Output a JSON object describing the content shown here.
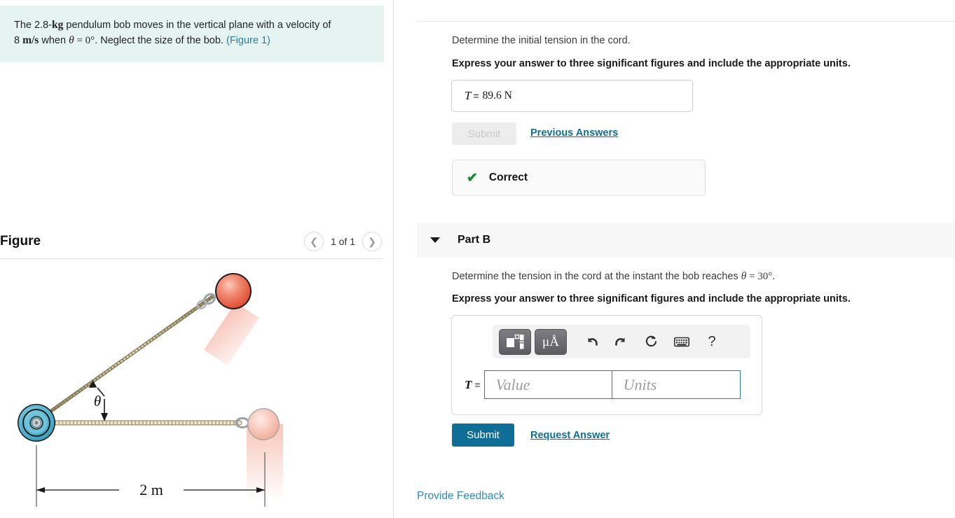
{
  "problem": {
    "line1_pre": "The 2.8-",
    "line1_unit": "kg",
    "line1_post": " pendulum bob moves in the vertical plane with a velocity of",
    "line2_pre": "8 ",
    "line2_unit": "m/s",
    "line2_mid": " when ",
    "line2_theta": "θ",
    "line2_eq": " = 0°",
    "line2_post": ". Neglect the size of the bob. ",
    "figure_link": "(Figure 1)"
  },
  "figure": {
    "title": "Figure",
    "counter": "1 of 1",
    "prev_icon": "chevron-left-icon",
    "next_icon": "chevron-right-icon",
    "theta_label": "θ",
    "dimension_label": "2 m",
    "pivot_color": "#5bbcd4",
    "bob_active_color": "#e8503a",
    "bob_ghost_color": "#f5b3a5",
    "cord_color": "#b9a878"
  },
  "partA": {
    "prompt": "Determine the initial tension in the cord.",
    "instruction": "Express your answer to three significant figures and include the appropriate units.",
    "answer_symbol": "T",
    "answer_equals": "=",
    "answer_value": "89.6 N",
    "submit_label": "Submit",
    "previous_answers_label": "Previous Answers",
    "status_icon": "check-icon",
    "status_label": "Correct",
    "status_color": "#198c2e"
  },
  "partB": {
    "caret_icon": "caret-down-icon",
    "title": "Part B",
    "prompt_pre": "Determine the tension in the cord at the instant the bob reaches ",
    "prompt_theta": "θ",
    "prompt_post": " = 30°.",
    "instruction": "Express your answer to three significant figures and include the appropriate units.",
    "toolbar": [
      {
        "name": "template-math-icon",
        "glyph": ""
      },
      {
        "name": "greek-symbol-icon",
        "glyph": "μÅ"
      },
      {
        "name": "undo-icon",
        "glyph": "↶"
      },
      {
        "name": "redo-icon",
        "glyph": "↷"
      },
      {
        "name": "reset-icon",
        "glyph": "↻"
      },
      {
        "name": "keyboard-icon",
        "glyph": "⌨"
      },
      {
        "name": "help-icon",
        "glyph": "?"
      }
    ],
    "answer_symbol": "T",
    "answer_equals": "=",
    "value_placeholder": "Value",
    "units_placeholder": "Units",
    "submit_label": "Submit",
    "request_answer_label": "Request Answer"
  },
  "footer": {
    "provide_feedback_label": "Provide Feedback"
  },
  "colors": {
    "accent": "#0e6e96",
    "link": "#2a8cb8",
    "problem_bg": "#e6f4f1",
    "band_bg": "#f7f7f7"
  }
}
